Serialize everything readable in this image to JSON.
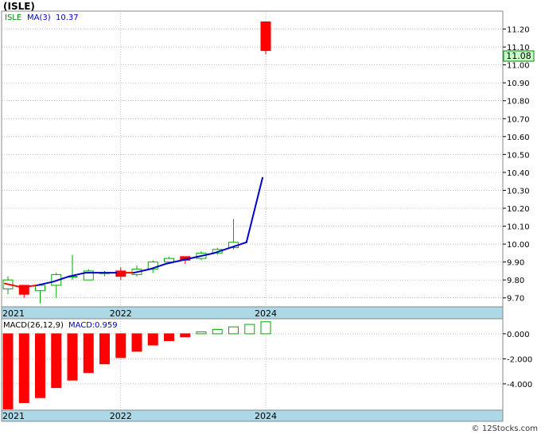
{
  "title": "(ISLE)",
  "legend": {
    "symbol": "ISLE",
    "ma_label": "MA(3)",
    "ma_value": "10.37",
    "macd_params": "MACD(26,12,9)",
    "macd_label": "MACD:",
    "macd_value": "0.959"
  },
  "last_price_label": "11.08",
  "watermark": "© 12Stocks.com",
  "colors": {
    "up": "#00aa00",
    "down": "#ff0000",
    "ma_up": "#0000cc",
    "ma_down": "#ff0000",
    "axis_band": "#add8e6",
    "last_price_bg": "#c8ffc8",
    "grid": "#999999"
  },
  "chart_data": [
    {
      "type": "candlestick",
      "title": "(ISLE)",
      "ylim": [
        9.65,
        11.3
      ],
      "y_ticks": [
        "9.70",
        "9.80",
        "9.90",
        "10.00",
        "10.10",
        "10.20",
        "10.30",
        "10.40",
        "10.50",
        "10.60",
        "10.70",
        "10.80",
        "10.90",
        "11.00",
        "11.10",
        "11.20"
      ],
      "x_labels": [
        {
          "text": "2021",
          "index": 0
        },
        {
          "text": "2022",
          "index": 7
        },
        {
          "text": "2024",
          "index": 16
        }
      ],
      "last_price": 11.08,
      "candles": [
        {
          "o": 9.75,
          "h": 9.82,
          "l": 9.72,
          "c": 9.8
        },
        {
          "o": 9.77,
          "h": 9.77,
          "l": 9.7,
          "c": 9.72
        },
        {
          "o": 9.74,
          "h": 9.78,
          "l": 9.67,
          "c": 9.77
        },
        {
          "o": 9.77,
          "h": 9.84,
          "l": 9.7,
          "c": 9.83
        },
        {
          "o": 9.82,
          "h": 9.94,
          "l": 9.8,
          "c": 9.82
        },
        {
          "o": 9.8,
          "h": 9.86,
          "l": 9.8,
          "c": 9.85
        },
        {
          "o": 9.84,
          "h": 9.85,
          "l": 9.82,
          "c": 9.84
        },
        {
          "o": 9.85,
          "h": 9.87,
          "l": 9.8,
          "c": 9.82
        },
        {
          "o": 9.83,
          "h": 9.88,
          "l": 9.82,
          "c": 9.86
        },
        {
          "o": 9.86,
          "h": 9.91,
          "l": 9.84,
          "c": 9.9
        },
        {
          "o": 9.9,
          "h": 9.93,
          "l": 9.89,
          "c": 9.92
        },
        {
          "o": 9.93,
          "h": 9.93,
          "l": 9.89,
          "c": 9.91
        },
        {
          "o": 9.92,
          "h": 9.96,
          "l": 9.91,
          "c": 9.95
        },
        {
          "o": 9.95,
          "h": 9.98,
          "l": 9.94,
          "c": 9.97
        },
        {
          "o": 9.98,
          "h": 10.14,
          "l": 9.97,
          "c": 10.01
        },
        null,
        {
          "o": 11.24,
          "h": 11.24,
          "l": 11.06,
          "c": 11.08
        }
      ],
      "ma": {
        "name": "MA(3)",
        "values": [
          9.78,
          9.76,
          9.77,
          9.79,
          9.82,
          9.84,
          9.84,
          9.84,
          9.84,
          9.86,
          9.89,
          9.91,
          9.93,
          9.95,
          9.98,
          10.01,
          10.37
        ],
        "colors": [
          "down",
          "down",
          "up",
          "up",
          "up",
          "up",
          "up",
          "down",
          "up",
          "up",
          "up",
          "up",
          "up",
          "up",
          "up",
          "up"
        ]
      }
    },
    {
      "type": "bar",
      "title": "MACD(26,12,9)",
      "ylim": [
        -6.1,
        1.2
      ],
      "y_ticks": [
        "0.000",
        "-2.000",
        "-4.000"
      ],
      "x_labels": [
        {
          "text": "2021",
          "index": 0
        },
        {
          "text": "2022",
          "index": 7
        },
        {
          "text": "2024",
          "index": 16
        }
      ],
      "values": [
        -6.0,
        -5.5,
        -5.1,
        -4.3,
        -3.7,
        -3.1,
        -2.4,
        -1.9,
        -1.4,
        -0.9,
        -0.55,
        -0.25,
        0.15,
        0.35,
        0.55,
        0.75,
        0.96
      ]
    }
  ]
}
